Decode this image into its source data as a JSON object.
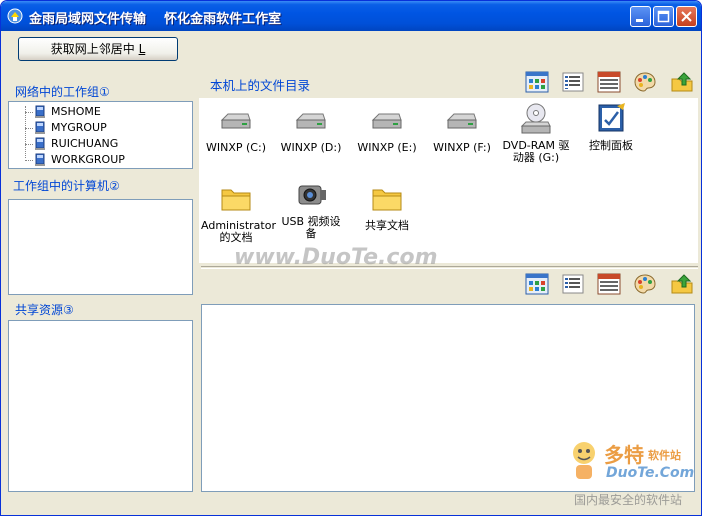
{
  "window": {
    "title": "金雨局域网文件传输    怀化金雨软件工作室"
  },
  "buttons": {
    "get_network": "获取网上邻居中",
    "get_network_hotkey": "L"
  },
  "sections": {
    "workgroups": "网络中的工作组①",
    "computers": "工作组中的计算机②",
    "shares": "共享资源③",
    "local_files": "本机上的文件目录"
  },
  "workgroups": [
    {
      "label": "MSHOME"
    },
    {
      "label": "MYGROUP"
    },
    {
      "label": "RUICHUANG"
    },
    {
      "label": "WORKGROUP"
    }
  ],
  "toolbar": {
    "icons": [
      "large-icons-view-icon",
      "list-view-icon",
      "details-view-icon",
      "palette-icon",
      "up-folder-icon"
    ]
  },
  "local_files": [
    {
      "label": "WINXP (C:)",
      "icon": "drive-icon"
    },
    {
      "label": "WINXP (D:)",
      "icon": "drive-icon"
    },
    {
      "label": "WINXP (E:)",
      "icon": "drive-icon"
    },
    {
      "label": "WINXP (F:)",
      "icon": "drive-icon"
    },
    {
      "label": "DVD-RAM 驱动器 (G:)",
      "icon": "dvd-drive-icon"
    },
    {
      "label": "控制面板",
      "icon": "control-panel-icon"
    },
    {
      "label": "Administrator 的文档",
      "icon": "folder-icon"
    },
    {
      "label": "USB 视频设备",
      "icon": "webcam-icon"
    },
    {
      "label": "共享文档",
      "icon": "folder-icon"
    }
  ],
  "watermarks": {
    "center": "www.DuoTe.com",
    "brand_title": "多特",
    "brand_sub": "软件站",
    "brand_url": "DuoTe.Com",
    "brand_slogan": "国内最安全的软件站"
  },
  "colors": {
    "titlebar": "#0055E3",
    "window_bg": "#ECE9D8",
    "label_blue": "#0046D5",
    "panel_border": "#7F9DB9"
  }
}
